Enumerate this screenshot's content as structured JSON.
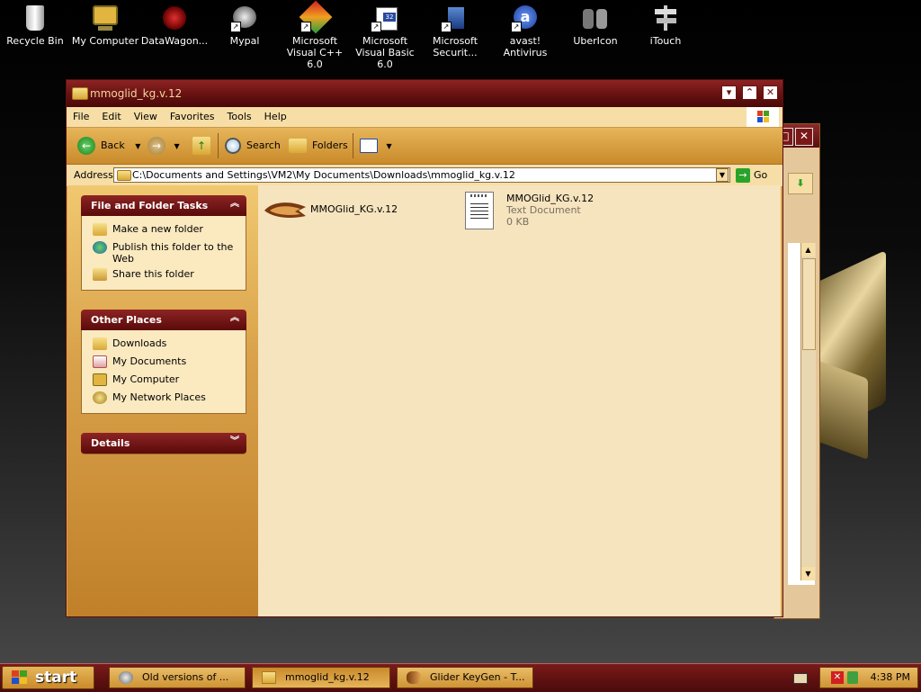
{
  "desktop": {
    "icons": [
      {
        "label": "Recycle Bin",
        "icon": "recycle-bin-icon"
      },
      {
        "label": "My Computer",
        "icon": "my-computer-icon"
      },
      {
        "label": "DataWagon...",
        "icon": "datawagon-icon"
      },
      {
        "label": "Mypal",
        "icon": "mypal-icon"
      },
      {
        "label": "Microsoft Visual C++ 6.0",
        "icon": "visual-cpp-icon"
      },
      {
        "label": "Microsoft Visual Basic 6.0",
        "icon": "visual-basic-icon"
      },
      {
        "label": "Microsoft Securit...",
        "icon": "microsoft-security-icon"
      },
      {
        "label": "avast! Antivirus",
        "icon": "avast-icon"
      },
      {
        "label": "UberIcon",
        "icon": "ubericon-icon"
      },
      {
        "label": "iTouch",
        "icon": "itouch-icon"
      }
    ]
  },
  "window": {
    "title": "mmoglid_kg.v.12",
    "menu": [
      "File",
      "Edit",
      "View",
      "Favorites",
      "Tools",
      "Help"
    ],
    "toolbar": {
      "back": "Back",
      "search": "Search",
      "folders": "Folders"
    },
    "address": {
      "label": "Address",
      "path": "C:\\Documents and Settings\\VM2\\My Documents\\Downloads\\mmoglid_kg.v.12",
      "go": "Go"
    },
    "tasks": {
      "title": "File and Folder Tasks",
      "items": [
        "Make a new folder",
        "Publish this folder to the Web",
        "Share this folder"
      ]
    },
    "places": {
      "title": "Other Places",
      "items": [
        "Downloads",
        "My Documents",
        "My Computer",
        "My Network Places"
      ]
    },
    "details": {
      "title": "Details"
    },
    "files": [
      {
        "name": "MMOGlid_KG.v.12",
        "type": "",
        "size": ""
      },
      {
        "name": "MMOGlid_KG.v.12",
        "type": "Text Document",
        "size": "0 KB"
      }
    ]
  },
  "taskbar": {
    "start": "start",
    "tasks": [
      "Old versions of ...",
      "mmoglid_kg.v.12",
      "Glider KeyGen - T..."
    ],
    "clock": "4:38 PM"
  },
  "colors": {
    "accent": "#6a1212",
    "gold": "#d6a24a",
    "pane": "#f6e4bf"
  }
}
